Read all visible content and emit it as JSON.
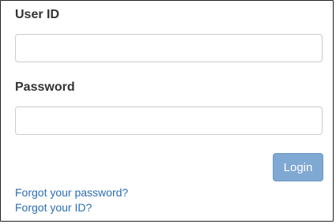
{
  "form": {
    "user_id_label": "User ID",
    "user_id_value": "",
    "password_label": "Password",
    "password_value": "",
    "login_label": "Login",
    "forgot_password_link": "Forgot your password?",
    "forgot_id_link": "Forgot your ID?"
  },
  "colors": {
    "login_button_bg": "#7fa8d2",
    "link": "#2a6db3",
    "border": "#222222"
  }
}
